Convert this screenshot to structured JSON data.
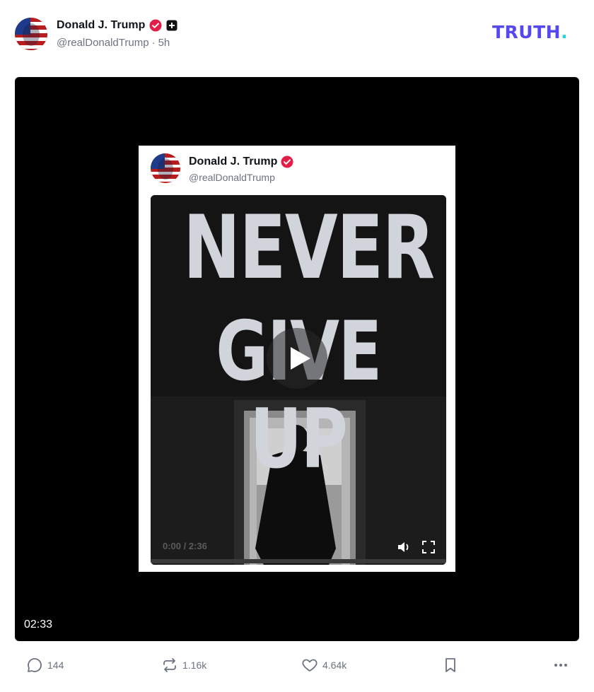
{
  "post": {
    "author_name": "Donald J. Trump",
    "handle": "@realDonaldTrump",
    "separator": "·",
    "time_ago": "5h"
  },
  "brand": {
    "logo_text": "TRUTH",
    "logo_dot": ".",
    "logo_color": "#5448ee",
    "dot_color": "#21d7d7"
  },
  "video": {
    "duration": "02:33",
    "embedded_post": {
      "author_name": "Donald J. Trump",
      "handle": "@realDonaldTrump",
      "headline_line1": "NEVER",
      "headline_line2": "GIVE UP",
      "time_display": "0:00 / 2:36"
    }
  },
  "actions": {
    "replies": "144",
    "retruths": "1.16k",
    "likes": "4.64k"
  },
  "icons": [
    "verified-badge-icon",
    "plus-badge-icon",
    "play-icon",
    "volume-icon",
    "fullscreen-icon",
    "reply-icon",
    "retruth-icon",
    "heart-icon",
    "bookmark-icon",
    "more-icon"
  ]
}
